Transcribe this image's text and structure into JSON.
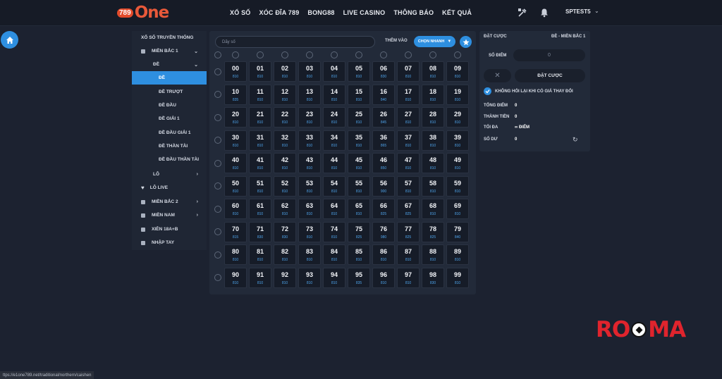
{
  "logo": {
    "number": "789",
    "word": "One"
  },
  "nav": [
    "XỔ SỐ",
    "XÓC ĐĨA 789",
    "BONG88",
    "LIVE CASINO",
    "THÔNG BÁO",
    "KẾT QUẢ"
  ],
  "user": {
    "name": "SPTEST5"
  },
  "icons": {
    "home": "home-icon",
    "tools": "tools-icon",
    "bell": "bell-icon",
    "star": "star-icon",
    "refresh": "refresh-icon"
  },
  "colors": {
    "accent": "#2e8fe0",
    "background": "#1c2230",
    "panel": "#222a39",
    "price": "#4ea3ea",
    "brand_red": "#e0242d"
  },
  "sidebar": {
    "items": [
      {
        "label": "XỔ SỐ TRUYỀN THỐNG",
        "icon": "",
        "chevron": "",
        "indent": "top",
        "active": false
      },
      {
        "label": "MIỀN BẮC 1",
        "icon": "grid-icon",
        "chevron": "⌄",
        "indent": "level1",
        "active": false
      },
      {
        "label": "ĐỀ",
        "icon": "",
        "chevron": "⌄",
        "indent": "level2",
        "active": false
      },
      {
        "label": "ĐỀ",
        "icon": "",
        "chevron": "",
        "indent": "level3",
        "active": true
      },
      {
        "label": "ĐỀ TRƯỢT",
        "icon": "",
        "chevron": "",
        "indent": "level3",
        "active": false
      },
      {
        "label": "ĐỀ ĐẦU",
        "icon": "",
        "chevron": "",
        "indent": "level3",
        "active": false
      },
      {
        "label": "ĐỀ GIẢI 1",
        "icon": "",
        "chevron": "",
        "indent": "level3",
        "active": false
      },
      {
        "label": "ĐỀ ĐẦU GIẢI 1",
        "icon": "",
        "chevron": "",
        "indent": "level3",
        "active": false
      },
      {
        "label": "ĐỀ THẦN TÀI",
        "icon": "",
        "chevron": "",
        "indent": "level3",
        "active": false
      },
      {
        "label": "ĐỀ ĐẦU THẦN TÀI",
        "icon": "",
        "chevron": "",
        "indent": "level3",
        "active": false
      },
      {
        "label": "LÔ",
        "icon": "",
        "chevron": "›",
        "indent": "level2",
        "active": false
      },
      {
        "label": "LÔ LIVE",
        "icon": "heart-icon",
        "chevron": "",
        "indent": "level1",
        "active": false
      },
      {
        "label": "MIỀN BẮC 2",
        "icon": "grid-icon",
        "chevron": "›",
        "indent": "level1",
        "active": false
      },
      {
        "label": "MIỀN NAM",
        "icon": "grid-icon",
        "chevron": "›",
        "indent": "level1",
        "active": false
      },
      {
        "label": "XIÊN 18A+B",
        "icon": "grid-icon",
        "chevron": "",
        "indent": "level1",
        "active": false
      },
      {
        "label": "NHẬP TAY",
        "icon": "grid-icon",
        "chevron": "",
        "indent": "level1",
        "active": false
      }
    ]
  },
  "board": {
    "search_placeholder": "Dãy số",
    "add_label": "THÊM VÀO",
    "quick_label": "CHỌN NHANH",
    "numbers": [
      [
        "00",
        "01",
        "02",
        "03",
        "04",
        "05",
        "06",
        "07",
        "08",
        "09"
      ],
      [
        "10",
        "11",
        "12",
        "13",
        "14",
        "15",
        "16",
        "17",
        "18",
        "19"
      ],
      [
        "20",
        "21",
        "22",
        "23",
        "24",
        "25",
        "26",
        "27",
        "28",
        "29"
      ],
      [
        "30",
        "31",
        "32",
        "33",
        "34",
        "35",
        "36",
        "37",
        "38",
        "39"
      ],
      [
        "40",
        "41",
        "42",
        "43",
        "44",
        "45",
        "46",
        "47",
        "48",
        "49"
      ],
      [
        "50",
        "51",
        "52",
        "53",
        "54",
        "55",
        "56",
        "57",
        "58",
        "59"
      ],
      [
        "60",
        "61",
        "62",
        "63",
        "64",
        "65",
        "66",
        "67",
        "68",
        "69"
      ],
      [
        "70",
        "71",
        "72",
        "73",
        "74",
        "75",
        "76",
        "77",
        "78",
        "79"
      ],
      [
        "80",
        "81",
        "82",
        "83",
        "84",
        "85",
        "86",
        "87",
        "88",
        "89"
      ],
      [
        "90",
        "91",
        "92",
        "93",
        "94",
        "95",
        "96",
        "97",
        "98",
        "99"
      ]
    ],
    "prices": [
      [
        "810",
        "810",
        "810",
        "810",
        "810",
        "810",
        "830",
        "810",
        "810",
        "810"
      ],
      [
        "835",
        "810",
        "810",
        "810",
        "810",
        "810",
        "840",
        "810",
        "810",
        "810"
      ],
      [
        "810",
        "810",
        "810",
        "810",
        "810",
        "810",
        "845",
        "810",
        "810",
        "810"
      ],
      [
        "810",
        "810",
        "810",
        "810",
        "810",
        "810",
        "865",
        "810",
        "810",
        "810"
      ],
      [
        "810",
        "810",
        "810",
        "810",
        "810",
        "810",
        "850",
        "810",
        "810",
        "810"
      ],
      [
        "810",
        "810",
        "810",
        "810",
        "810",
        "810",
        "900",
        "810",
        "810",
        "810"
      ],
      [
        "810",
        "810",
        "810",
        "810",
        "810",
        "810",
        "825",
        "825",
        "810",
        "810"
      ],
      [
        "815",
        "830",
        "830",
        "810",
        "810",
        "825",
        "980",
        "825",
        "825",
        "840"
      ],
      [
        "810",
        "810",
        "810",
        "810",
        "810",
        "810",
        "810",
        "810",
        "810",
        "810"
      ],
      [
        "810",
        "810",
        "810",
        "810",
        "810",
        "835",
        "810",
        "810",
        "830",
        "810"
      ]
    ]
  },
  "bet_panel": {
    "title": "ĐẶT CƯỢC",
    "market": "ĐỀ - MIỀN BẮC 1",
    "points_label": "SỐ ĐIỂM",
    "points_value": "0",
    "clear_label": "✕",
    "submit_label": "ĐẶT CƯỢC",
    "keep_label": "KHÔNG HỎI LẠI KHI CÓ GIÁ THAY ĐỔI",
    "total_points_label": "TỔNG ĐIỂM",
    "total_points_value": "0",
    "amount_label": "THÀNH TIỀN",
    "amount_value": "0",
    "max_label": "TỐI ĐA",
    "max_value": "∞ ĐIỂM",
    "balance_label": "SỐ DƯ",
    "balance_value": "0"
  },
  "watermark": {
    "text_left": "RO",
    "text_right": "MA"
  },
  "status_url": "ttps://e1one789.net/traditional/northern/caishen"
}
